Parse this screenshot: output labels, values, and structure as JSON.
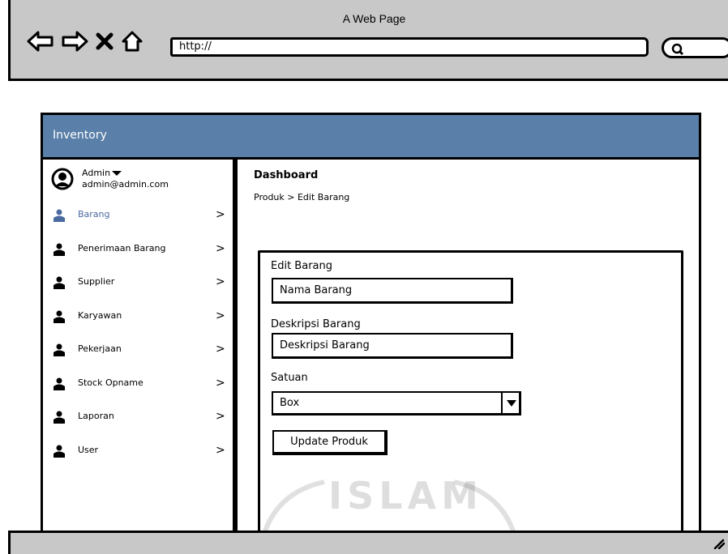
{
  "window": {
    "title": "A Web Page",
    "url": "http://"
  },
  "app": {
    "title": "Inventory"
  },
  "user": {
    "name": "Admin",
    "email": "admin@admin.com"
  },
  "menu": [
    {
      "label": "Barang",
      "icon": "user-icon",
      "active": true
    },
    {
      "label": "Penerimaan Barang",
      "icon": "user-icon",
      "active": false
    },
    {
      "label": "Supplier",
      "icon": "user-icon",
      "active": false
    },
    {
      "label": "Karyawan",
      "icon": "user-icon",
      "active": false
    },
    {
      "label": "Pekerjaan",
      "icon": "user-icon",
      "active": false
    },
    {
      "label": "Stock Opname",
      "icon": "user-icon",
      "active": false
    },
    {
      "label": "Laporan",
      "icon": "user-icon",
      "active": false
    },
    {
      "label": "User",
      "icon": "user-icon",
      "active": false
    }
  ],
  "chevron": ">",
  "main": {
    "title": "Dashboard",
    "breadcrumb": "Produk > Edit Barang"
  },
  "form": {
    "heading": "Edit Barang",
    "nama_value": "Nama Barang",
    "deskripsi_label": "Deskripsi Barang",
    "deskripsi_value": "Deskripsi Barang",
    "satuan_label": "Satuan",
    "satuan_value": "Box",
    "submit_label": "Update Produk"
  },
  "watermark": "ISLAM",
  "colors": {
    "header_bg": "#5a7fa8",
    "chrome_bg": "#c8c8c8",
    "active_menu": "#4a6aa0"
  }
}
